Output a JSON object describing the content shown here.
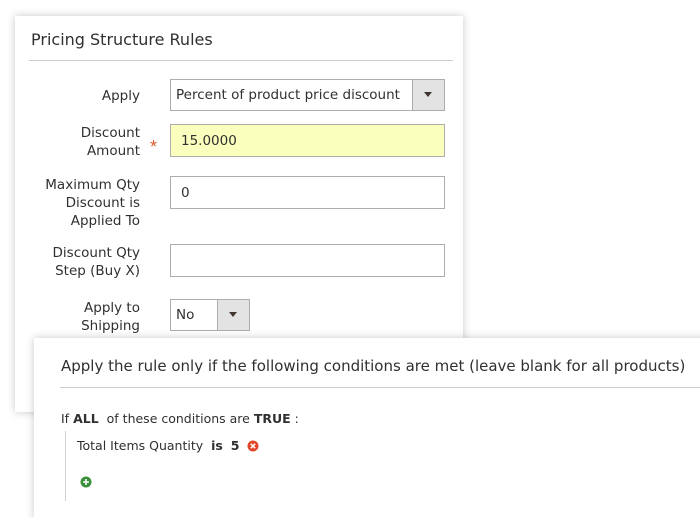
{
  "pricing": {
    "title": "Pricing Structure Rules",
    "apply_label": "Apply",
    "apply_value": "Percent of product price discount",
    "discount_amount_label": "Discount Amount",
    "discount_amount_required": "*",
    "discount_amount_value": "15.0000",
    "max_qty_label": "Maximum Qty Discount is Applied To",
    "max_qty_value": "0",
    "qty_step_label": "Discount Qty Step (Buy X)",
    "qty_step_value": "",
    "apply_shipping_label": "Apply to Shipping",
    "apply_shipping_value": "No"
  },
  "conditions": {
    "title": "Apply the rule only if the following conditions are met (leave blank for all products)",
    "if_text": "If",
    "aggregator": "ALL",
    "middle_text": "of these conditions are",
    "value": "TRUE",
    "suffix": ":",
    "rule_attribute": "Total Items Quantity",
    "rule_operator": "is",
    "rule_value": "5"
  },
  "colors": {
    "highlight_field": "#faffbd",
    "required_star": "#e05a2b",
    "remove_icon": "#e0472b",
    "add_icon": "#3a8f3a"
  }
}
